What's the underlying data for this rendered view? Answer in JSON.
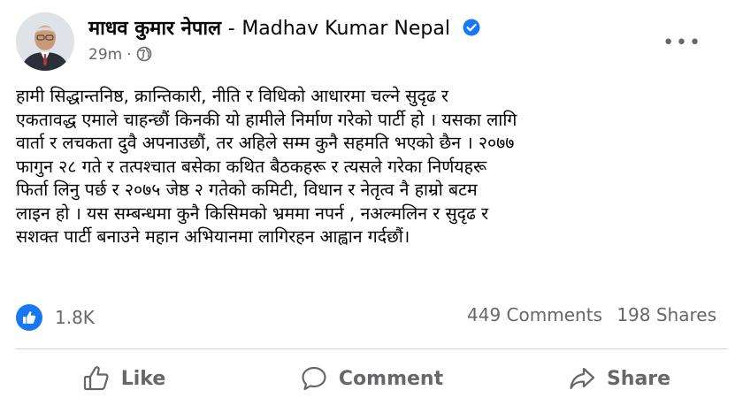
{
  "post": {
    "author_ne": "माधव कुमार नेपाल",
    "separator": "-",
    "author_en": "Madhav Kumar Nepal",
    "time": "29m",
    "meta_dot": "·",
    "more_glyph": "•••",
    "text": "हामी सिद्धान्तनिष्ठ, क्रान्तिकारी, नीति र विधिको आधारमा चल्ने सुदृढ र\nएकतावद्ध एमाले चाहन्छौं किनकी यो हामीले निर्माण गरेको पार्टी हो । यसका लागि\nवार्ता र लचकता दुवै अपनाउछौं, तर अहिले सम्म कुनै सहमति भएको छैन । २०७७\nफागुन २८ गते र तत्पश्चात बसेका कथित बैठकहरू र त्यसले गरेका निर्णयहरू\nफिर्ता लिनु पर्छ र २०७५ जेष्ठ २ गतेको कमिटी, विधान र नेतृत्व नै हाम्रो बटम\nलाइन हो ।  यस सम्बन्धमा कुनै किसिमको भ्रममा नपर्न , नअल्मलिन र सुदृढ र\nसशक्त पार्टी बनाउने महान अभियानमा लागिरहन आह्वान गर्दछौं।"
  },
  "stats": {
    "reactions": "1.8K",
    "comments": "449 Comments",
    "shares": "198 Shares"
  },
  "actions": {
    "like": "Like",
    "comment": "Comment",
    "share": "Share"
  },
  "colors": {
    "brand_blue": "#1877f2",
    "secondary_text": "#65676b"
  },
  "icons": [
    "avatar",
    "verified-badge-icon",
    "globe-icon",
    "more-options-icon",
    "like-reaction-icon",
    "like-icon",
    "comment-icon",
    "share-icon"
  ]
}
